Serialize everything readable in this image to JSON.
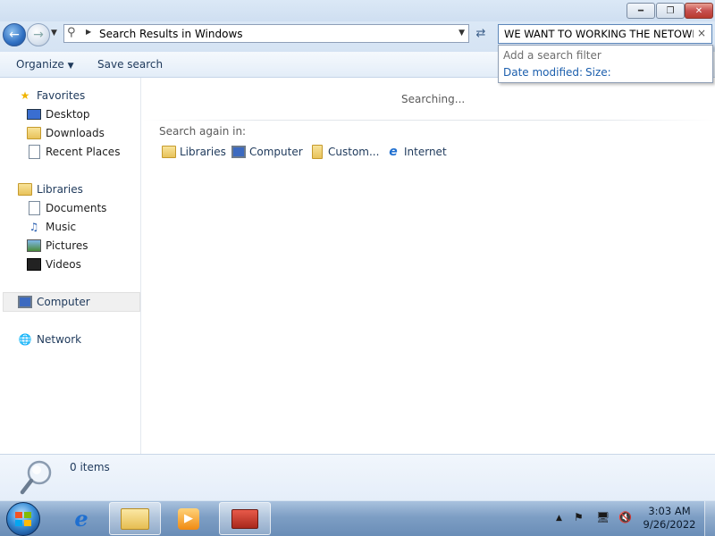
{
  "window": {
    "minimize_icon": "minimize-icon",
    "maximize_icon": "restore-icon",
    "close_icon": "close-icon"
  },
  "address_bar": {
    "path": "Search Results in Windows",
    "search_query": "WE WANT TO WORKING THE NETOWR",
    "search_clear": "×"
  },
  "search_filter": {
    "add_label": "Add a search filter",
    "filters": [
      "Date modified:",
      "Size:"
    ]
  },
  "toolbar": {
    "organize_label": "Organize",
    "save_search_label": "Save search"
  },
  "nav": {
    "favorites": {
      "label": "Favorites",
      "items": [
        "Desktop",
        "Downloads",
        "Recent Places"
      ]
    },
    "libraries": {
      "label": "Libraries",
      "items": [
        "Documents",
        "Music",
        "Pictures",
        "Videos"
      ]
    },
    "computer_label": "Computer",
    "network_label": "Network"
  },
  "content": {
    "status": "Searching...",
    "search_again_label": "Search again in:",
    "search_again_items": [
      "Libraries",
      "Computer",
      "Custom...",
      "Internet"
    ]
  },
  "details": {
    "count": "0 items"
  },
  "taskbar": {
    "time": "3:03 AM",
    "date": "9/26/2022",
    "apps": [
      "internet-explorer",
      "windows-explorer",
      "media-player",
      "toolbox"
    ]
  },
  "colors": {
    "accent": "#1c5fad",
    "taskbar": "#7d9ec4",
    "close_button": "#c75050"
  }
}
